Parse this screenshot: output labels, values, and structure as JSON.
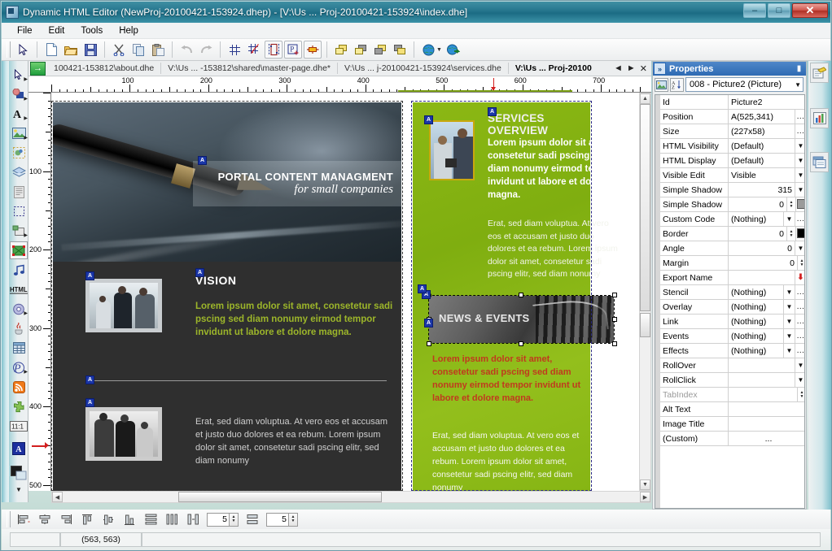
{
  "window": {
    "title": "Dynamic HTML Editor (NewProj-20100421-153924.dhep) - [V:\\Us ... Proj-20100421-153924\\index.dhe]",
    "app_icon": "app-icon",
    "minimize": "–",
    "maximize": "□",
    "close": "✕"
  },
  "menu": {
    "items": [
      "File",
      "Edit",
      "Tools",
      "Help"
    ]
  },
  "toolbar": {
    "groups": [
      {
        "items": [
          {
            "name": "pointer-icon",
            "label": "Pointer"
          }
        ]
      },
      {
        "items": [
          {
            "name": "new-file-icon",
            "label": "New"
          },
          {
            "name": "open-folder-icon",
            "label": "Open"
          },
          {
            "name": "save-icon",
            "label": "Save"
          }
        ]
      },
      {
        "items": [
          {
            "name": "cut-scissors-icon",
            "label": "Cut"
          },
          {
            "name": "copy-icon",
            "label": "Copy"
          },
          {
            "name": "paste-icon",
            "label": "Paste"
          }
        ]
      },
      {
        "items": [
          {
            "name": "undo-icon",
            "label": "Undo"
          },
          {
            "name": "redo-icon",
            "label": "Redo"
          }
        ]
      },
      {
        "items": [
          {
            "name": "grid-icon",
            "label": "Show Grid"
          },
          {
            "name": "grid-snap-icon",
            "label": "Snap To Grid"
          },
          {
            "name": "guides-icon",
            "label": "Guides",
            "active": true
          },
          {
            "name": "page-marker-icon",
            "label": "Page Marker",
            "active": true
          },
          {
            "name": "object-marker-icon",
            "label": "Object Marker",
            "active": true
          }
        ]
      },
      {
        "items": [
          {
            "name": "bring-to-front-icon",
            "label": "Bring To Front"
          },
          {
            "name": "bring-forward-icon",
            "label": "Bring Forward"
          },
          {
            "name": "send-backward-icon",
            "label": "Send Backward"
          },
          {
            "name": "send-to-back-icon",
            "label": "Send To Back"
          }
        ]
      },
      {
        "items": [
          {
            "name": "preview-browser-icon",
            "label": "Preview"
          },
          {
            "name": "publish-globe-icon",
            "label": "Publish"
          }
        ]
      }
    ]
  },
  "left_palette": {
    "items": [
      {
        "name": "select-tool",
        "label": "Select",
        "arrow": true
      },
      {
        "name": "shape-tool",
        "label": "Shape",
        "arrow": true
      },
      {
        "name": "text-tool",
        "label": "Text",
        "arrow": true
      },
      {
        "name": "image-tool",
        "label": "Image",
        "arrow": true
      },
      {
        "name": "hotspot-tool",
        "label": "Hotspot",
        "arrow": false
      },
      {
        "name": "layers-tool",
        "label": "Layers",
        "arrow": false
      },
      {
        "name": "document-tool",
        "label": "Document",
        "arrow": false
      },
      {
        "name": "marquee-tool",
        "label": "Marquee",
        "arrow": false
      },
      {
        "name": "form-tool",
        "label": "Form",
        "arrow": true
      },
      {
        "name": "flash-tool",
        "label": "Flash / Media",
        "arrow": false,
        "selected": true
      },
      {
        "name": "audio-tool",
        "label": "Audio",
        "arrow": false
      },
      {
        "name": "html-tool",
        "label": "HTML",
        "arrow": false
      },
      {
        "name": "media-player-tool",
        "label": "Media Player",
        "arrow": true
      },
      {
        "name": "java-tool",
        "label": "Java",
        "arrow": false
      },
      {
        "name": "table-tool",
        "label": "Table",
        "arrow": false
      },
      {
        "name": "php-tool",
        "label": "PHP",
        "arrow": true
      },
      {
        "name": "rss-tool",
        "label": "RSS",
        "arrow": false
      },
      {
        "name": "plugin-tool",
        "label": "Plugin",
        "arrow": false
      },
      {
        "name": "ratio-tool",
        "label": "11:1 Ratio",
        "arrow": false
      },
      {
        "name": "anchor-tool",
        "label": "Anchor",
        "arrow": false
      },
      {
        "name": "color-tool",
        "label": "Color",
        "arrow": false
      }
    ],
    "more": "▼"
  },
  "tabs": {
    "home_icon": "home-arrow-icon",
    "items": [
      {
        "label": "100421-153812\\about.dhe",
        "selected": false
      },
      {
        "label": "V:\\Us ... -153812\\shared\\master-page.dhe*",
        "selected": false
      },
      {
        "label": "V:\\Us ... j-20100421-153924\\services.dhe",
        "selected": false
      },
      {
        "label": "V:\\Us ... Proj-20100",
        "selected": true
      }
    ],
    "nav_prev": "◄",
    "nav_next": "►",
    "nav_close": "✕"
  },
  "rulers": {
    "horizontal_labels": [
      "100",
      "200",
      "300",
      "400",
      "500",
      "600",
      "700"
    ],
    "vertical_labels": [
      "100",
      "200",
      "300",
      "400",
      "500"
    ],
    "h_marker_value": "563",
    "v_marker_value": "563"
  },
  "canvas": {
    "left_page": {
      "hero": {
        "headline": "PORTAL CONTENT MANAGMENT",
        "subline": "for small companies"
      },
      "vision": {
        "title": "VISION",
        "body": "Lorem ipsum dolor sit amet, consetetur sadi pscing sed diam nonumy eirmod tempor invidunt ut labore et dolore magna."
      },
      "erat": {
        "body": "Erat, sed diam voluptua. At vero eos et accusam et justo duo dolores et ea rebum. Lorem ipsum dolor sit amet, consetetur sadi pscing elitr, sed diam nonumy"
      }
    },
    "green_page": {
      "services": {
        "title": "SERVICES OVERVIEW",
        "bold_body": "Lorem ipsum dolor sit amet, consetetur sadi pscing sed diam nonumy eirmod tempor invidunt ut labore et dolore magna.",
        "body": "Erat, sed diam voluptua. At vero eos et accusam et justo duo dolores et ea rebum. Lorem ipsum dolor sit amet, consetetur sadi pscing elitr, sed diam nonumy"
      },
      "news": {
        "title": "NEWS & EVENTS",
        "bold_body": "Lorem ipsum dolor sit amet, consetetur sadi pscing sed diam nonumy eirmod tempor invidunt ut labore et dolore magna.",
        "body": "Erat, sed diam voluptua. At vero eos et accusam et justo duo dolores et ea rebum. Lorem ipsum dolor sit amet, consetetur sadi pscing elitr, sed diam nonumy"
      }
    }
  },
  "properties": {
    "panel_title": "Properties",
    "expand_icon": "»",
    "pin_icon": "▮",
    "selector_value": "008 - Picture2 (Picture)",
    "selector_arrow": "❯",
    "rows": [
      {
        "name": "Id",
        "value": "Picture2",
        "ctrl": "none",
        "align": "left"
      },
      {
        "name": "Position",
        "value": "A(525,341)",
        "ctrl": "dots",
        "align": "left"
      },
      {
        "name": "Size",
        "value": "(227x58)",
        "ctrl": "dots",
        "align": "left"
      },
      {
        "name": "HTML Visibility",
        "value": "(Default)",
        "ctrl": "combo",
        "align": "left"
      },
      {
        "name": "HTML Display",
        "value": "(Default)",
        "ctrl": "combo",
        "align": "left"
      },
      {
        "name": "Visible Edit",
        "value": "Visible",
        "ctrl": "combo",
        "align": "left"
      },
      {
        "name": "Simple Shadow",
        "value": "315",
        "ctrl": "combo",
        "align": "right"
      },
      {
        "name": "Simple Shadow",
        "value": "0",
        "ctrl": "spin-swatch",
        "align": "right",
        "swatch": "#9b9b9b"
      },
      {
        "name": "Custom Code",
        "value": "(Nothing)",
        "ctrl": "combo-dots",
        "align": "left"
      },
      {
        "name": "Border",
        "value": "0",
        "ctrl": "spin-swatch",
        "align": "right",
        "swatch": "#000000"
      },
      {
        "name": "Angle",
        "value": "0",
        "ctrl": "combo",
        "align": "right"
      },
      {
        "name": "Margin",
        "value": "0",
        "ctrl": "spin",
        "align": "right"
      },
      {
        "name": "Export Name",
        "value": "",
        "ctrl": "red-arrow",
        "align": "left"
      },
      {
        "name": "Stencil",
        "value": "(Nothing)",
        "ctrl": "combo-dots",
        "align": "left"
      },
      {
        "name": "Overlay",
        "value": "(Nothing)",
        "ctrl": "combo-dots",
        "align": "left"
      },
      {
        "name": "Link",
        "value": "(Nothing)",
        "ctrl": "combo-dots",
        "align": "left"
      },
      {
        "name": "Events",
        "value": "(Nothing)",
        "ctrl": "combo-dots",
        "align": "left"
      },
      {
        "name": "Effects",
        "value": "(Nothing)",
        "ctrl": "combo-dots",
        "align": "left"
      },
      {
        "name": "RollOver",
        "value": "",
        "ctrl": "combo",
        "align": "left"
      },
      {
        "name": "RollClick",
        "value": "",
        "ctrl": "combo",
        "align": "left"
      },
      {
        "name": "TabIndex",
        "value": "",
        "ctrl": "spin",
        "align": "left",
        "disabled": true
      },
      {
        "name": "Alt Text",
        "value": "",
        "ctrl": "none",
        "align": "left"
      },
      {
        "name": "Image Title",
        "value": "",
        "ctrl": "none",
        "align": "left"
      },
      {
        "name": "(Custom)",
        "value": "...",
        "ctrl": "none",
        "align": "center"
      }
    ]
  },
  "right_buttons": [
    {
      "name": "page-properties-icon",
      "label": "Page Properties"
    },
    {
      "name": "statistics-icon",
      "label": "Statistics"
    },
    {
      "name": "objects-list-icon",
      "label": "Objects List"
    }
  ],
  "bottom_toolbar": {
    "buttons": [
      {
        "name": "align-left-icon",
        "label": "Align Left"
      },
      {
        "name": "align-center-horizontal-icon",
        "label": "Align Center"
      },
      {
        "name": "align-right-icon",
        "label": "Align Right"
      },
      {
        "name": "align-top-icon",
        "label": "Align Top"
      },
      {
        "name": "align-middle-icon",
        "label": "Align Middle"
      },
      {
        "name": "align-bottom-icon",
        "label": "Align Bottom"
      },
      {
        "name": "distribute-vertical-icon",
        "label": "Distribute Vertically"
      },
      {
        "name": "distribute-horizontal-icon",
        "label": "Distribute Horizontally"
      },
      {
        "name": "space-equal-icon",
        "label": "Space Equally"
      }
    ],
    "spacing_h_value": "5",
    "spacing_v_value": "5",
    "make-same-size-icon": "Make Same Size"
  },
  "statusbar": {
    "coordinates": "(563, 563)",
    "message": ""
  },
  "colors": {
    "titlebar": "#2b7b92",
    "accent_green": "#8cb814",
    "vision_text": "#9cb52a",
    "news_text": "#c03a1e",
    "selection_blue": "#1a36a8",
    "props_header": "#2e6bb3"
  }
}
